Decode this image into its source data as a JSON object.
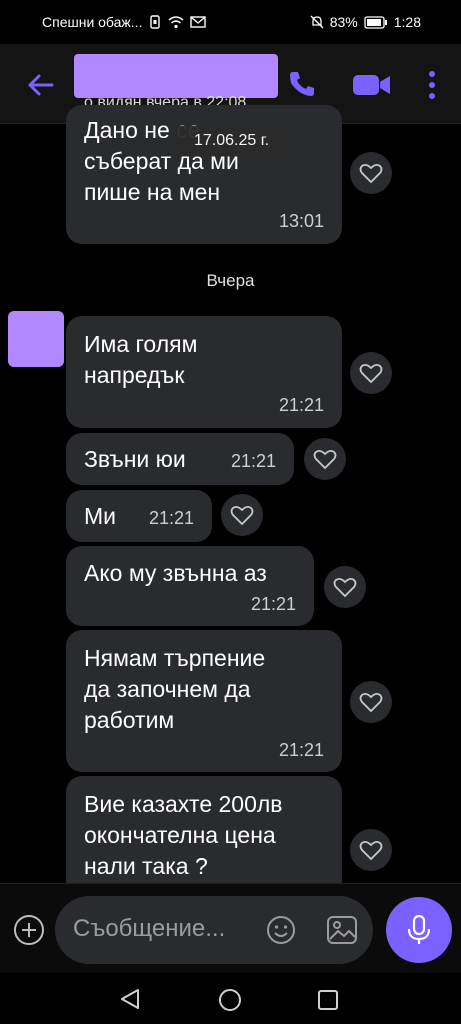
{
  "status_bar": {
    "left_text": "Спешни обаж...",
    "battery": "83%",
    "time": "1:28"
  },
  "header": {
    "last_seen": "о видян вчера в 22:08",
    "icons": [
      "back-arrow-icon",
      "phone-icon",
      "video-camera-icon",
      "more-vertical-icon"
    ]
  },
  "date_pill": "17.06.25 г.",
  "messages": [
    {
      "text": "Дано не се\nсъберат да ми\nпише на мен",
      "time": "13:01"
    },
    {
      "text": "Има голям\nнапредък",
      "time": "21:21"
    },
    {
      "text": "Звъни юи",
      "time": "21:21"
    },
    {
      "text": "Ми",
      "time": "21:21"
    },
    {
      "text": "Ако му звънна аз",
      "time": "21:21"
    },
    {
      "text": "Нямам търпение\nда започнем да\nработим",
      "time": "21:21"
    },
    {
      "text": "Вие казахте 200лв\nокончателна цена\nнали така ?",
      "time": ""
    }
  ],
  "day_divider": "Вчера",
  "composer": {
    "placeholder": "Съобщение..."
  },
  "colors": {
    "accent": "#7b61ff",
    "bubble": "#2a2b2f",
    "redaction": "#b388ff"
  }
}
